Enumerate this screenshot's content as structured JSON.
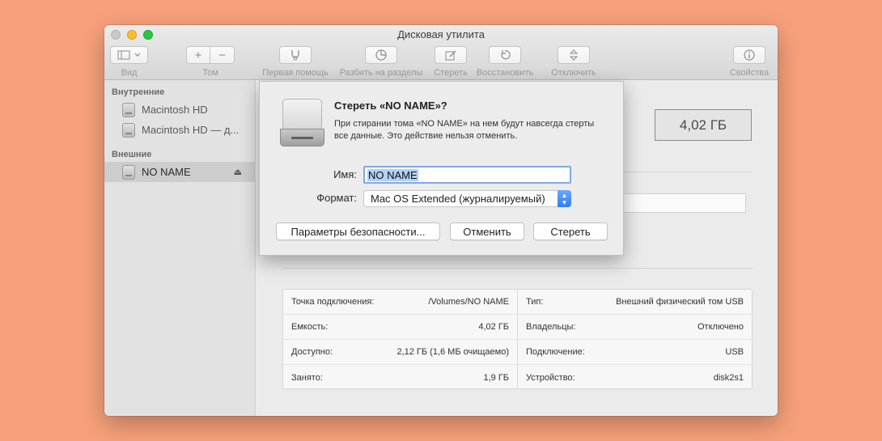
{
  "window": {
    "title": "Дисковая утилита"
  },
  "toolbar": {
    "view_label": "Вид",
    "volume_label": "Том",
    "first_aid_label": "Первая помощь",
    "partition_label": "Разбить на разделы",
    "erase_label": "Стереть",
    "restore_label": "Восстановить",
    "unmount_label": "Отключить",
    "info_label": "Свойства",
    "add_glyph": "+",
    "remove_glyph": "−"
  },
  "sidebar": {
    "internal_header": "Внутренние",
    "external_header": "Внешние",
    "internal_items": [
      {
        "label": "Macintosh HD"
      },
      {
        "label": "Macintosh HD — д..."
      }
    ],
    "external_items": [
      {
        "label": "NO NAME",
        "selected": true,
        "eject": "⏏"
      }
    ]
  },
  "main": {
    "capacity": "4,02 ГБ",
    "info_left": [
      {
        "label": "Точка подключения:",
        "value": "/Volumes/NO NAME"
      },
      {
        "label": "Емкость:",
        "value": "4,02 ГБ"
      },
      {
        "label": "Доступно:",
        "value": "2,12 ГБ (1,6 МБ очищаемо)"
      },
      {
        "label": "Занято:",
        "value": "1,9 ГБ"
      }
    ],
    "info_right": [
      {
        "label": "Тип:",
        "value": "Внешний физический том USB"
      },
      {
        "label": "Владельцы:",
        "value": "Отключено"
      },
      {
        "label": "Подключение:",
        "value": "USB"
      },
      {
        "label": "Устройство:",
        "value": "disk2s1"
      }
    ]
  },
  "dialog": {
    "title": "Стереть «NO NAME»?",
    "message": "При стирании тома «NO NAME» на нем будут навсегда стерты все данные. Это действие нельзя отменить.",
    "name_label": "Имя:",
    "name_value": "NO NAME",
    "format_label": "Формат:",
    "format_value": "Mac OS Extended (журналируемый)",
    "security_button": "Параметры безопасности...",
    "cancel_button": "Отменить",
    "erase_button": "Стереть"
  },
  "colors": {
    "background": "#f7a07b",
    "accent": "#2f7df2",
    "selection": "#b3d0f5"
  }
}
